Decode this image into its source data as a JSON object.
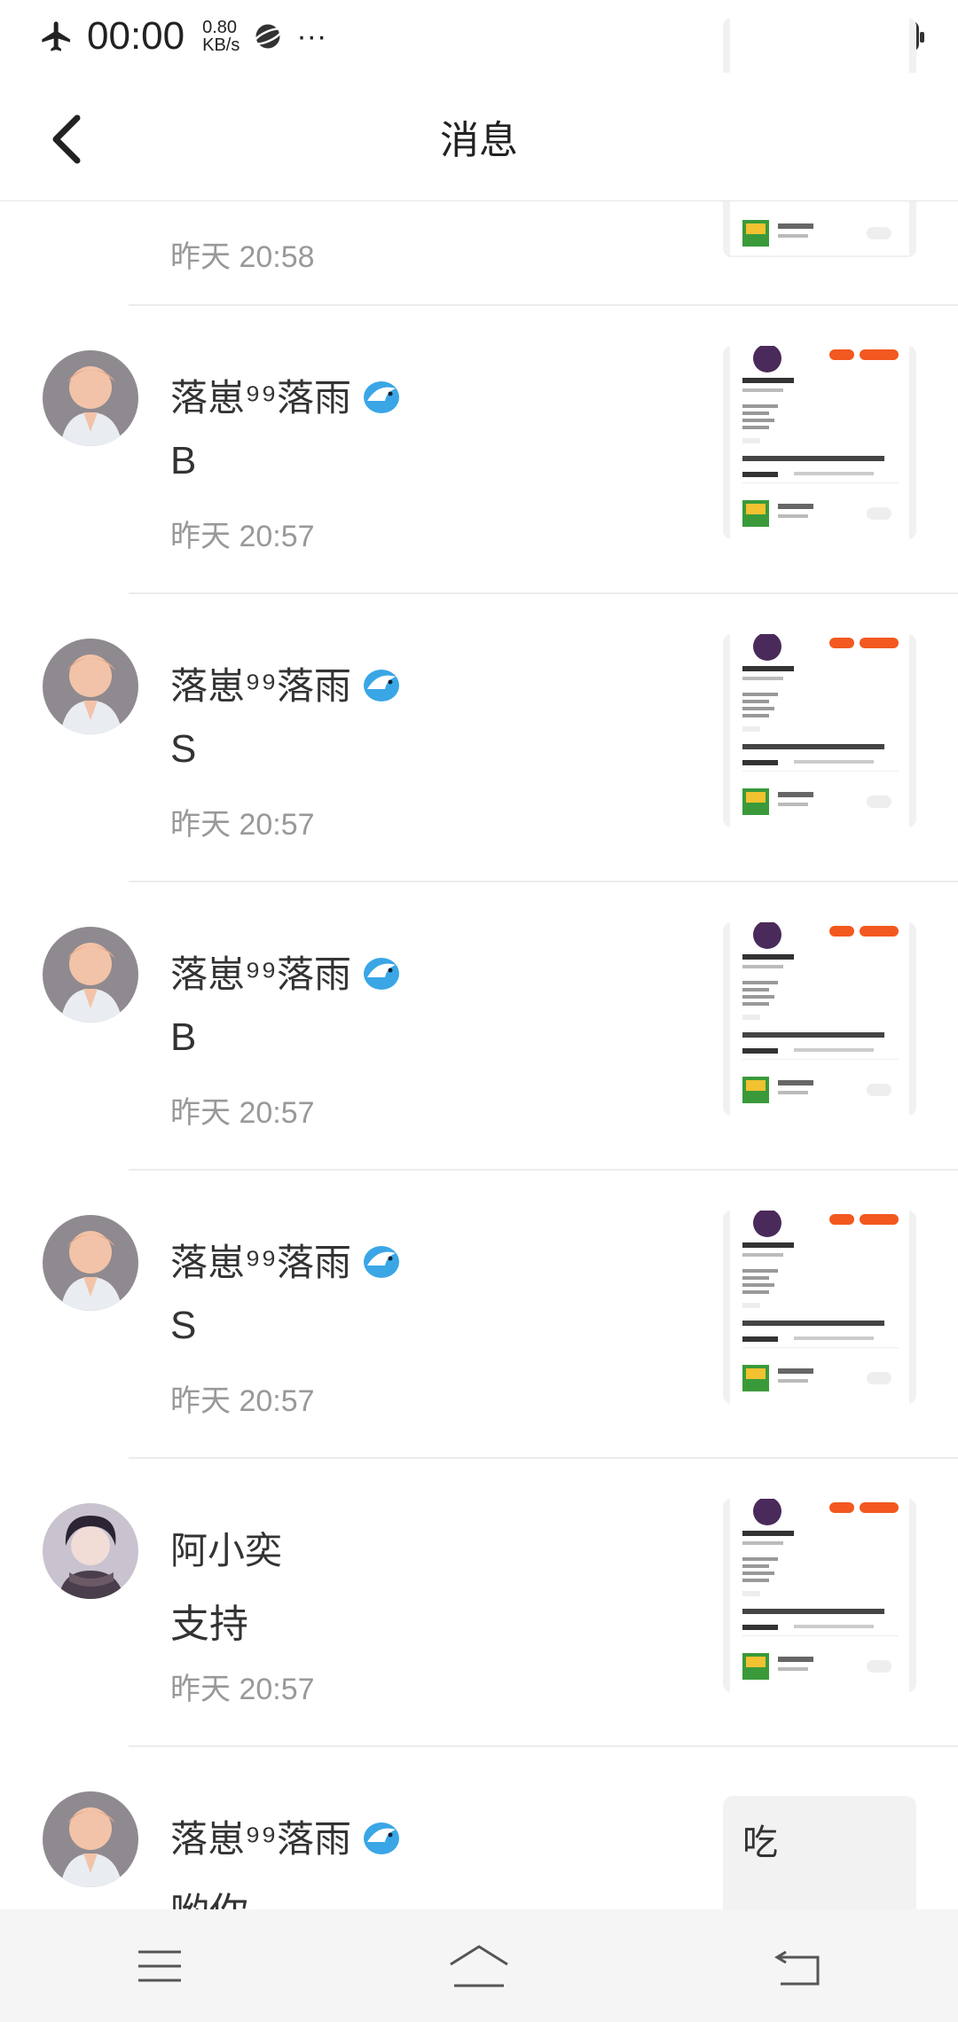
{
  "status_bar": {
    "time": "00:00",
    "speed_value": "0.80",
    "speed_unit": "KB/s",
    "more": "···",
    "battery": "35"
  },
  "header": {
    "title": "消息"
  },
  "messages": [
    {
      "name": "",
      "content": "",
      "time": "昨天 20:58",
      "avatar": "boy",
      "thumb": "profile"
    },
    {
      "name": "落崽⁹⁹落雨",
      "content": "B",
      "time": "昨天 20:57",
      "avatar": "boy",
      "thumb": "profile"
    },
    {
      "name": "落崽⁹⁹落雨",
      "content": "S",
      "time": "昨天 20:57",
      "avatar": "boy",
      "thumb": "profile"
    },
    {
      "name": "落崽⁹⁹落雨",
      "content": "B",
      "time": "昨天 20:57",
      "avatar": "boy",
      "thumb": "profile"
    },
    {
      "name": "落崽⁹⁹落雨",
      "content": "S",
      "time": "昨天 20:57",
      "avatar": "boy",
      "thumb": "profile"
    },
    {
      "name": "阿小奕",
      "content": "支持",
      "time": "昨天 20:57",
      "avatar": "dark-hair",
      "thumb": "profile"
    },
    {
      "name": "落崽⁹⁹落雨",
      "content": "哟你...",
      "time": "",
      "avatar": "boy",
      "thumb": "text",
      "thumb_text": "吃"
    }
  ],
  "profile_card": {
    "name": "落雨⁹⁹落崽",
    "follow": "关注",
    "add_friend": "加好友",
    "stats": [
      "449关注",
      "637粉丝",
      "6602获赞"
    ],
    "section": "最近在玩",
    "tabs": [
      "作品榜",
      "帖子",
      "评论"
    ],
    "game": "迷你世界",
    "view": "查看"
  },
  "colors": {
    "accent": "#f2581f",
    "time_gray": "#999999",
    "divider": "#ececec"
  },
  "nav": {
    "menu": "menu-icon",
    "home": "home-icon",
    "back": "back-icon"
  }
}
